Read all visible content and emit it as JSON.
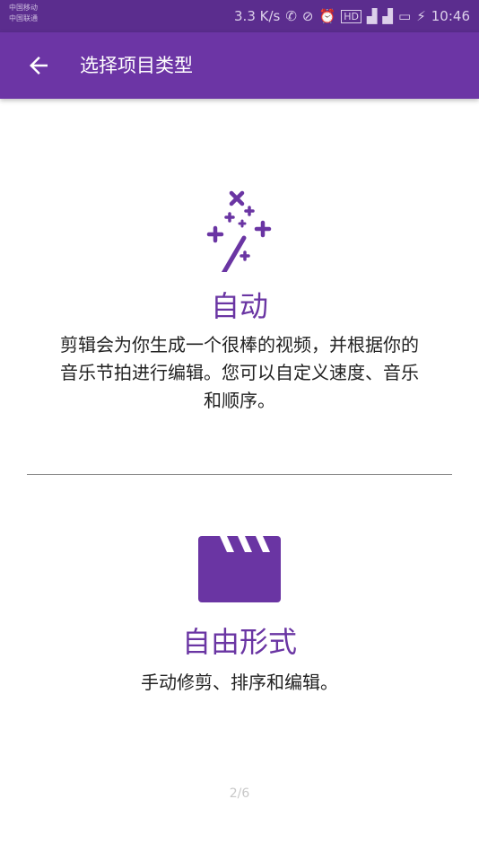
{
  "status_bar": {
    "carrier_1": "中国移动",
    "carrier_2": "中国联通",
    "speed": "3.3 K/s",
    "time": "10:46",
    "icons": [
      "call-icon",
      "no-notification-icon",
      "alarm-icon",
      "hd-icon",
      "signal-icon",
      "signal-icon",
      "battery-icon",
      "charging-icon"
    ]
  },
  "app_bar": {
    "title": "选择项目类型",
    "back_icon": "arrow-back-icon"
  },
  "options": {
    "auto": {
      "icon": "magic-wand-icon",
      "title": "自动",
      "description": "剪辑会为你生成一个很棒的视频，并根据你的音乐节拍进行编辑。您可以自定义速度、音乐和顺序。"
    },
    "free": {
      "icon": "clapperboard-icon",
      "title": "自由形式",
      "description": "手动修剪、排序和编辑。"
    }
  },
  "page_indicator": "2/6",
  "colors": {
    "status_bar": "#5b2d8e",
    "app_bar": "#6c35a5",
    "accent": "#6a35a3",
    "divider": "#8a8a8a",
    "text": "#222222"
  }
}
